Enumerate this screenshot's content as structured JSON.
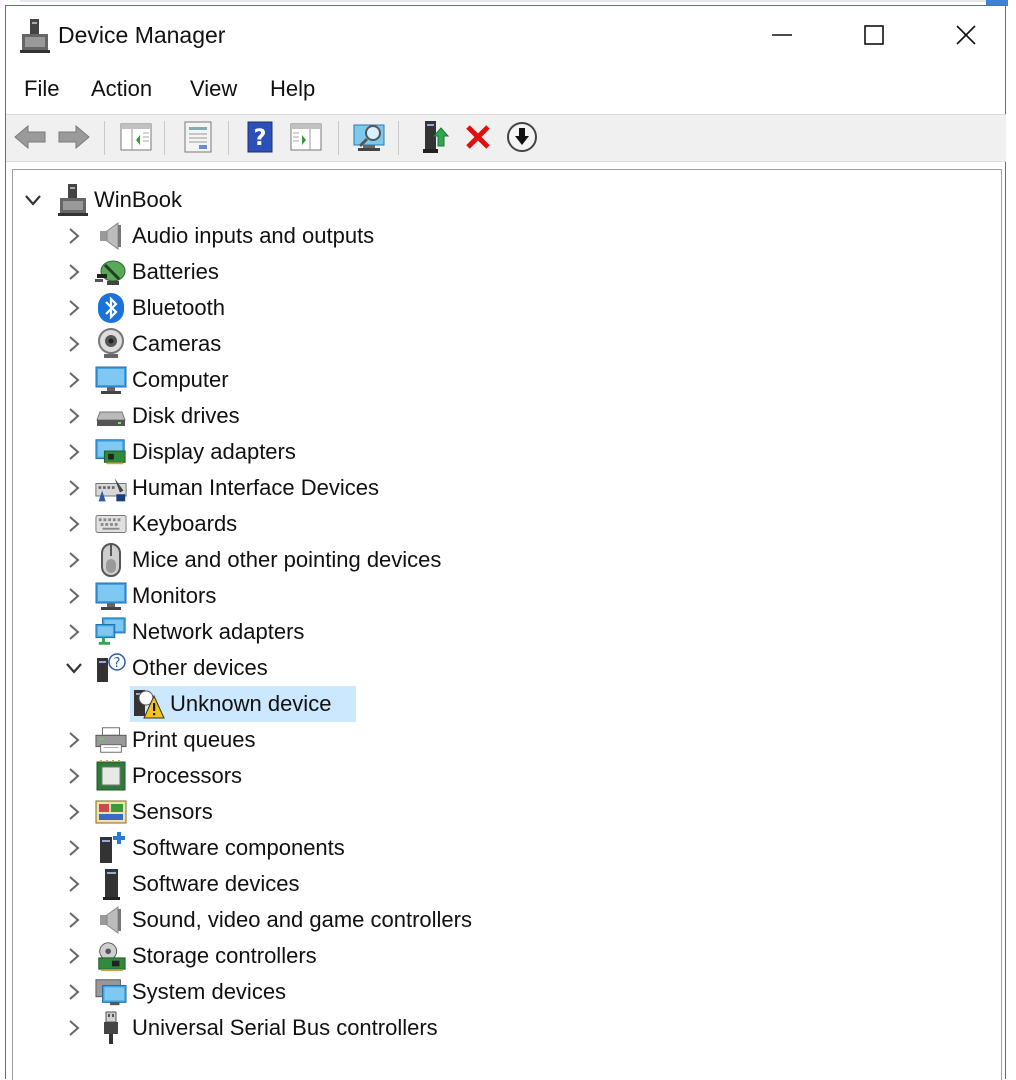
{
  "window": {
    "title": "Device Manager"
  },
  "menu": [
    "File",
    "Action",
    "View",
    "Help"
  ],
  "toolbar_icons": [
    "back-arrow-icon",
    "forward-arrow-icon",
    "show-hide-console-tree-icon",
    "properties-icon",
    "help-icon",
    "action-pane-icon",
    "scan-hardware-icon",
    "update-driver-icon",
    "uninstall-device-icon",
    "disable-device-icon"
  ],
  "tree": {
    "root": {
      "label": "WinBook",
      "expanded": true,
      "icon": "computer-root-icon"
    },
    "categories": [
      {
        "label": "Audio inputs and outputs",
        "icon": "speaker-icon"
      },
      {
        "label": "Batteries",
        "icon": "battery-icon"
      },
      {
        "label": "Bluetooth",
        "icon": "bluetooth-icon"
      },
      {
        "label": "Cameras",
        "icon": "camera-icon"
      },
      {
        "label": "Computer",
        "icon": "monitor-icon"
      },
      {
        "label": "Disk drives",
        "icon": "disk-drive-icon"
      },
      {
        "label": "Display adapters",
        "icon": "display-adapter-icon"
      },
      {
        "label": "Human Interface Devices",
        "icon": "hid-icon"
      },
      {
        "label": "Keyboards",
        "icon": "keyboard-icon"
      },
      {
        "label": "Mice and other pointing devices",
        "icon": "mouse-icon"
      },
      {
        "label": "Monitors",
        "icon": "monitor-icon"
      },
      {
        "label": "Network adapters",
        "icon": "network-adapter-icon"
      },
      {
        "label": "Other devices",
        "icon": "other-devices-icon",
        "expanded": true,
        "children": [
          {
            "label": "Unknown device",
            "icon": "unknown-device-warning-icon",
            "selected": true
          }
        ]
      },
      {
        "label": "Print queues",
        "icon": "printer-icon"
      },
      {
        "label": "Processors",
        "icon": "processor-icon"
      },
      {
        "label": "Sensors",
        "icon": "sensor-icon"
      },
      {
        "label": "Software components",
        "icon": "software-component-icon"
      },
      {
        "label": "Software devices",
        "icon": "software-device-icon"
      },
      {
        "label": "Sound, video and game controllers",
        "icon": "speaker-icon"
      },
      {
        "label": "Storage controllers",
        "icon": "storage-controller-icon"
      },
      {
        "label": "System devices",
        "icon": "system-devices-icon"
      },
      {
        "label": "Universal Serial Bus controllers",
        "icon": "usb-icon"
      }
    ]
  },
  "colors": {
    "selection": "#cce8ff",
    "window_border": "#2b7bd5",
    "toolbar_bg": "#f0f0f0"
  }
}
